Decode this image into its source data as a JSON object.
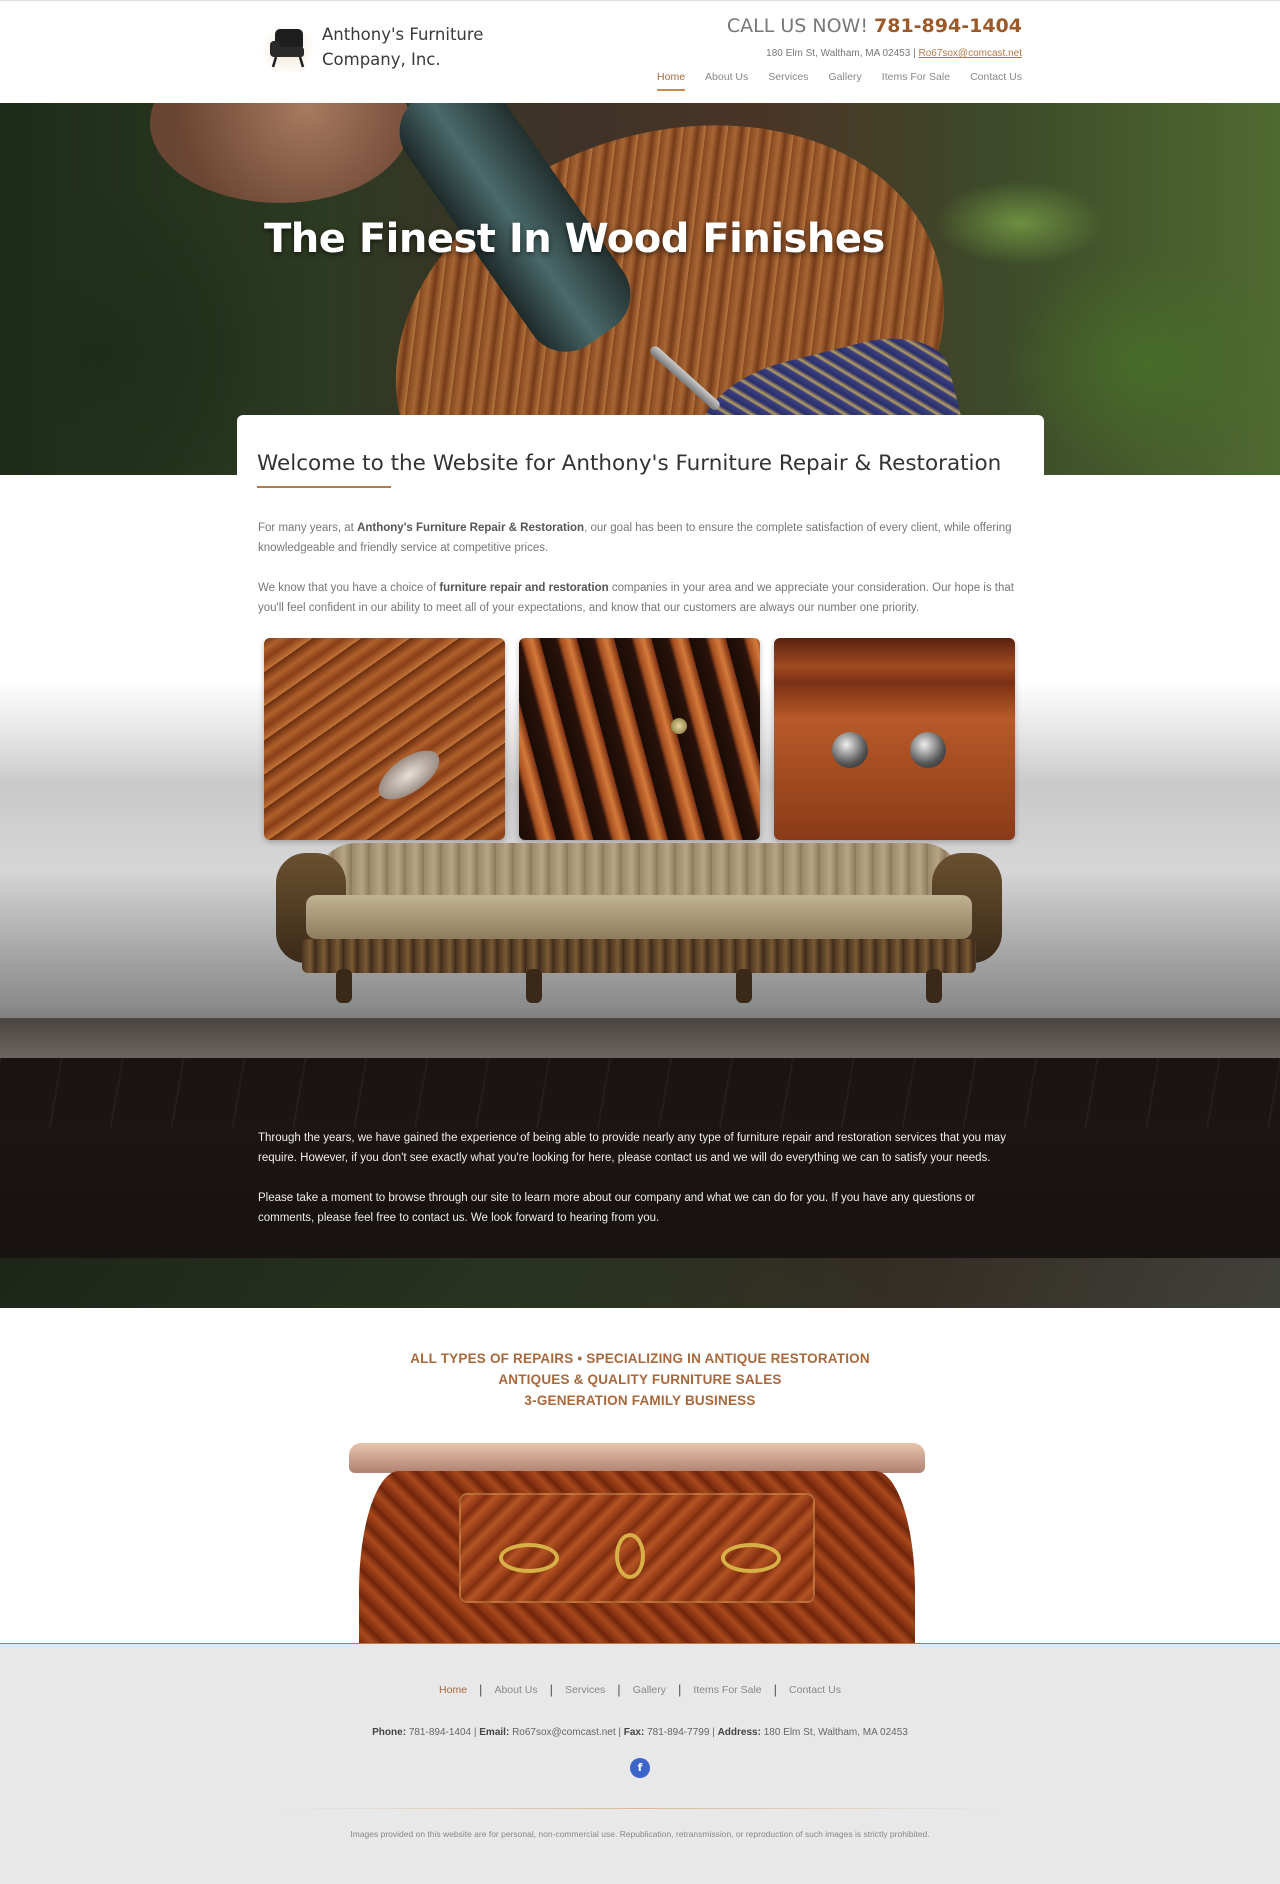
{
  "header": {
    "brand_line1": "Anthony's Furniture",
    "brand_line2": "Company, Inc.",
    "call_prefix": "CALL US NOW!",
    "call_number": "781-894-1404",
    "address": "180 Elm St, Waltham, MA 02453",
    "separator": "|",
    "email": "Ro67sox@comcast.net",
    "nav": [
      "Home",
      "About Us",
      "Services",
      "Gallery",
      "Items For Sale",
      "Contact Us"
    ],
    "active_nav": "Home"
  },
  "hero": {
    "title": "The Finest In Wood Finishes"
  },
  "welcome": {
    "heading": "Welcome to the Website for Anthony's Furniture Repair & Restoration",
    "p1_a": "For many years, at ",
    "p1_bold": "Anthony's Furniture Repair & Restoration",
    "p1_b": ", our goal has been to ensure the complete satisfaction of every client, while offering knowledgeable and friendly service at competitive prices.",
    "p2_a": "We know that you have a choice of ",
    "p2_bold": "furniture repair and restoration",
    "p2_b": " companies in your area and we appreciate your consideration. Our hope is that you'll feel confident in our ability to meet all of your expectations, and know that our customers are always our number one priority."
  },
  "experience": {
    "p1": "Through the years, we have gained the experience of being able to provide nearly any type of furniture repair and restoration services that you may require. However, if you don't see exactly what you're looking for here, please contact us and we will do everything we can to satisfy your needs.",
    "p2": "Please take a moment to browse through our site to learn more about our company and what we can do for you. If you have any questions or comments, please feel free to contact us. We look forward to hearing from you."
  },
  "specialties": [
    "ALL TYPES OF REPAIRS • SPECIALIZING IN ANTIQUE RESTORATION",
    "ANTIQUES & QUALITY FURNITURE SALES",
    "3-GENERATION FAMILY BUSINESS"
  ],
  "footer": {
    "nav": [
      "Home",
      "About Us",
      "Services",
      "Gallery",
      "Items For Sale",
      "Contact Us"
    ],
    "separator": "|",
    "phone_label": "Phone:",
    "phone": "781-894-1404",
    "email_label": "Email:",
    "email": "Ro67sox@comcast.net",
    "fax_label": "Fax:",
    "fax": "781-894-7799",
    "address_label": "Address:",
    "address": "180 Elm St, Waltham, MA 02453",
    "facebook_glyph": "f",
    "disclaimer": "Images provided on this website are for personal, non-commercial use. Republication, retransmission, or reproduction of such images is strictly prohibited."
  },
  "colors": {
    "accent": "#a8683c",
    "facebook": "#3b65c8",
    "footer_bg": "#e8e8e8"
  },
  "icons": {
    "logo": "armchair-icon",
    "social": "facebook-icon"
  }
}
